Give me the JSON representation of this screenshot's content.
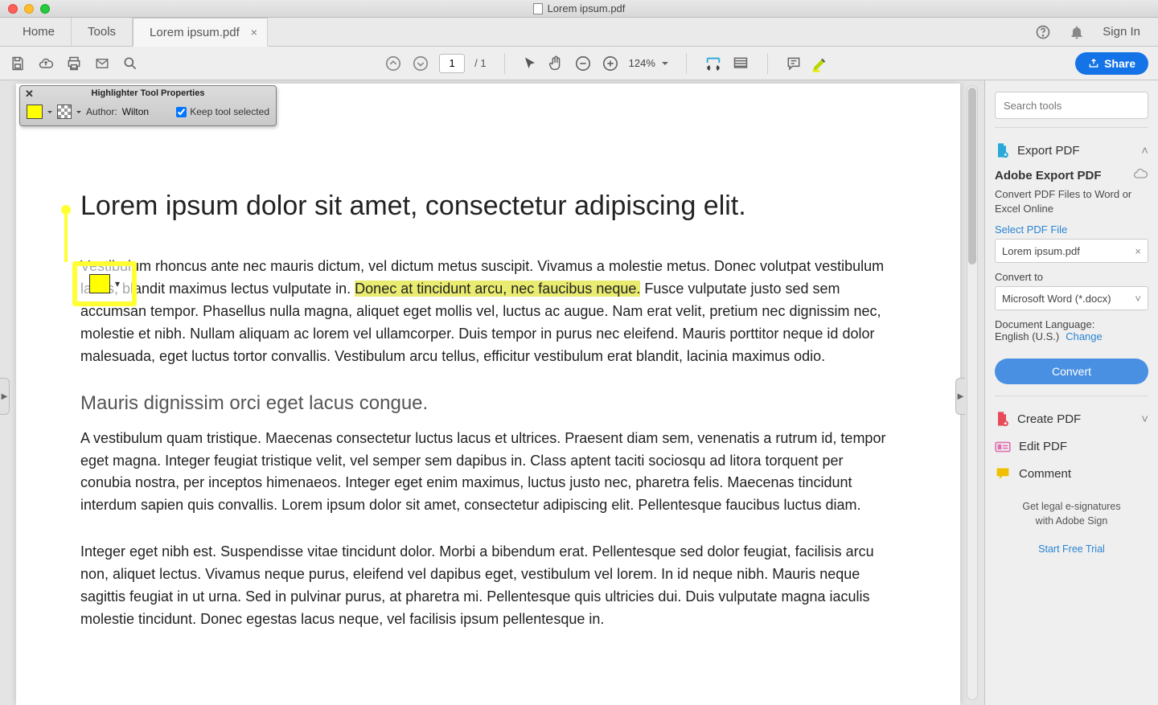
{
  "window": {
    "title": "Lorem ipsum.pdf"
  },
  "tabs": {
    "home": "Home",
    "tools": "Tools",
    "doc_name": "Lorem ipsum.pdf",
    "sign_in": "Sign In"
  },
  "toolbar": {
    "page_current": "1",
    "page_total": "/  1",
    "zoom": "124%",
    "share": "Share"
  },
  "hl_props": {
    "title": "Highlighter Tool Properties",
    "author_label": "Author:",
    "author_value": "Wilton",
    "keep_selected": "Keep tool selected"
  },
  "doc": {
    "h1": "Lorem ipsum dolor sit amet, consectetur adipiscing elit.",
    "p1a": "Vestibulum rhoncus ante nec mauris dictum, vel dictum metus suscipit. Vivamus a molestie metus. Donec volutpat vestibulum lacus, blandit maximus lectus vulputate in. ",
    "p1_hl": "Donec at tincidunt arcu, nec faucibus neque.",
    "p1b": " Fusce vulputate justo sed sem accumsan tempor. Phasellus nulla magna, aliquet eget mollis vel, luctus ac augue. Nam erat velit, pretium nec dignissim nec, molestie et nibh. Nullam aliquam ac lorem vel ullamcorper. Duis tempor in purus nec eleifend. Mauris porttitor neque id dolor malesuada, eget luctus tortor convallis. Vestibulum arcu tellus, efficitur vestibulum erat blandit, lacinia maximus odio.",
    "h2": "Mauris dignissim orci eget lacus congue.",
    "p2": "A vestibulum quam tristique. Maecenas consectetur luctus lacus et ultrices. Praesent diam sem, venenatis a rutrum id, tempor eget magna. Integer feugiat tristique velit, vel semper sem dapibus in. Class aptent taciti sociosqu ad litora torquent per conubia nostra, per inceptos himenaeos. Integer eget enim maximus, luctus justo nec, pharetra felis. Maecenas tincidunt interdum sapien quis convallis. Lorem ipsum dolor sit amet, consectetur adipiscing elit. Pellentesque faucibus luctus diam.",
    "p3": "Integer eget nibh est. Suspendisse vitae tincidunt dolor. Morbi a bibendum erat. Pellentesque sed dolor feugiat, facilisis arcu non, aliquet lectus. Vivamus neque purus, eleifend vel dapibus eget, vestibulum vel lorem. In id neque nibh. Mauris neque sagittis feugiat in ut urna. Sed in pulvinar purus, at pharetra mi. Pellentesque quis ultricies dui. Duis vulputate magna iaculis molestie tincidunt. Donec egestas lacus neque, vel facilisis ipsum pellentesque in."
  },
  "sidebar": {
    "search_placeholder": "Search tools",
    "export_pdf": "Export PDF",
    "export_heading": "Adobe Export PDF",
    "export_desc": "Convert PDF Files to Word or Excel Online",
    "select_file_label": "Select PDF File",
    "selected_file": "Lorem ipsum.pdf",
    "convert_to_label": "Convert to",
    "convert_option": "Microsoft Word (*.docx)",
    "doc_lang_label": "Document Language:",
    "doc_lang_value": "English (U.S.)",
    "change": "Change",
    "convert_btn": "Convert",
    "create_pdf": "Create PDF",
    "edit_pdf": "Edit PDF",
    "comment": "Comment",
    "sign_blurb_1": "Get legal e-signatures",
    "sign_blurb_2": "with Adobe Sign",
    "start_trial": "Start Free Trial"
  }
}
